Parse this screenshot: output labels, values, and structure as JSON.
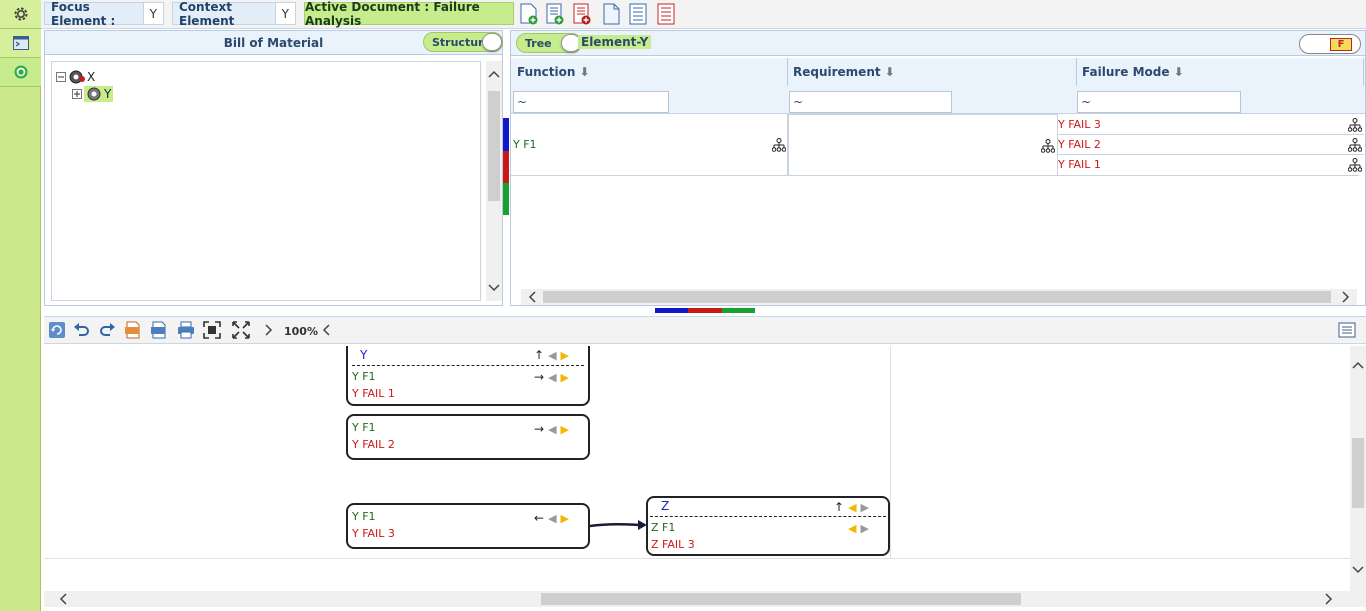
{
  "toolbar": {
    "focus_label": "Focus Element :",
    "focus_value": "Y",
    "context_label": "Context Element",
    "context_value": "Y",
    "active_document": "Active Document : Failure Analysis"
  },
  "bom": {
    "title": "Bill of Material",
    "toggle_label": "Structure",
    "tree": [
      {
        "label": "X",
        "expanded": true
      },
      {
        "label": "Y",
        "expanded": false,
        "selected": true
      }
    ]
  },
  "failure_analysis": {
    "tree_toggle": "Tree",
    "element_label": "Element-Y",
    "badge": "F",
    "columns": [
      {
        "title": "Function",
        "filter": "~"
      },
      {
        "title": "Requirement",
        "filter": "~"
      },
      {
        "title": "Failure Mode",
        "filter": "~"
      }
    ],
    "rows": {
      "function": "Y F1",
      "requirement": "",
      "failure_modes": [
        "Y FAIL 3",
        "Y FAIL 2",
        "Y FAIL 1"
      ]
    },
    "stripe_colors": [
      "#1018c8",
      "#c81818",
      "#18a030"
    ]
  },
  "diagram": {
    "zoom": "100%",
    "nodes": [
      {
        "header": "Y",
        "function": "Y F1",
        "failure": "Y FAIL 1",
        "arrow": "↑",
        "func_arrow": "→"
      },
      {
        "header": "",
        "function": "Y F1",
        "failure": "Y FAIL 2",
        "func_arrow": "→"
      },
      {
        "header": "",
        "function": "Y F1",
        "failure": "Y FAIL 3",
        "func_arrow": "←"
      },
      {
        "header": "Z",
        "function": "Z F1",
        "failure": "Z FAIL 3",
        "arrow": "↑"
      }
    ]
  },
  "colors": {
    "accent_green": "#c7ec8d",
    "header_blue": "#eaf2fb",
    "function_green": "#1e6b1e",
    "failure_red": "#cc1a1a"
  }
}
